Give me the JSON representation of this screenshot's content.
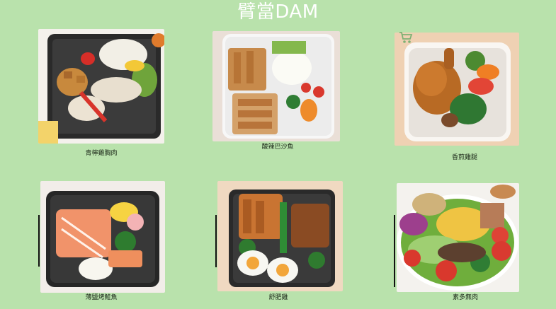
{
  "page": {
    "title": "臂當DAM"
  },
  "menu": {
    "items": [
      {
        "name": "青檸雞胸肉"
      },
      {
        "name": "酸辣巴沙魚"
      },
      {
        "name": "香煎雞腿"
      },
      {
        "name": "薄鹽烤鮭魚"
      },
      {
        "name": "舒肥雞"
      },
      {
        "name": "素多無肉"
      }
    ]
  },
  "icons": {
    "cart": "shopping-cart-icon"
  },
  "colors": {
    "background": "#b9e2ac",
    "title": "#ffffff"
  }
}
